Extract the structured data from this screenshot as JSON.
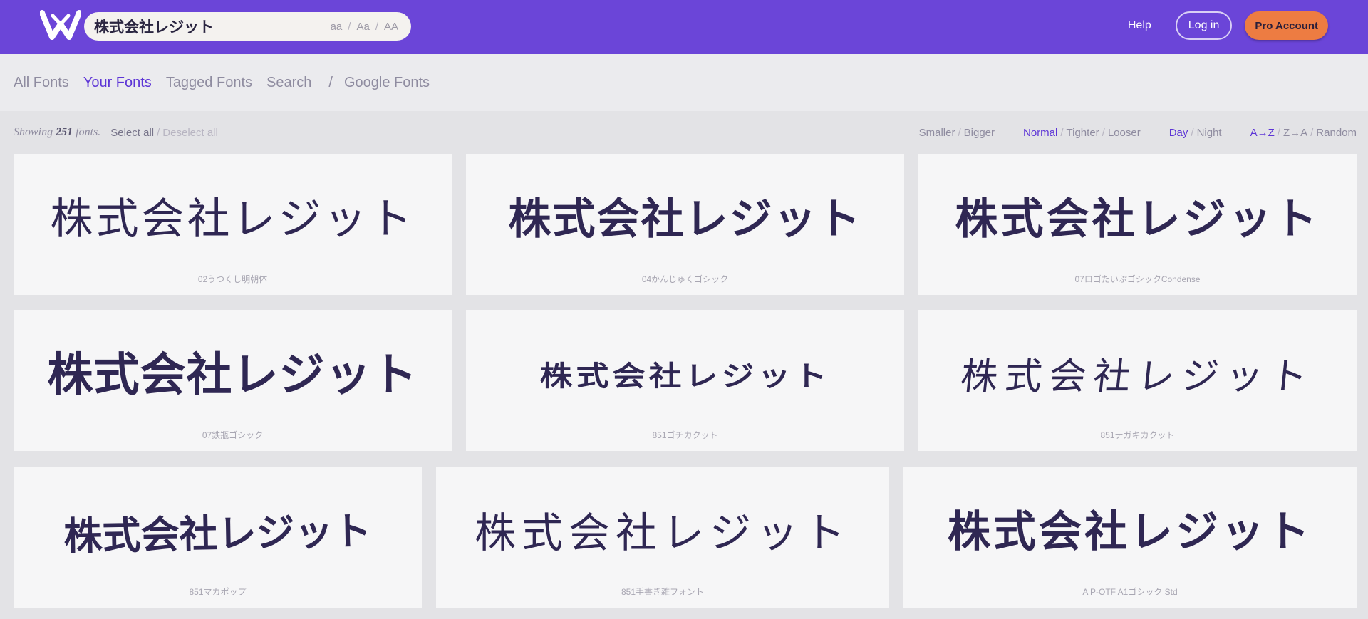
{
  "header": {
    "search_value": "株式会社レジット",
    "case_options": [
      "aa",
      "Aa",
      "AA"
    ],
    "help_label": "Help",
    "login_label": "Log in",
    "pro_label": "Pro Account"
  },
  "nav": {
    "tabs": [
      "All Fonts",
      "Your Fonts",
      "Tagged Fonts",
      "Search"
    ],
    "active": "Your Fonts",
    "google_label": "Google Fonts"
  },
  "toolbar": {
    "showing_prefix": "Showing",
    "count": "251",
    "showing_suffix": "fonts.",
    "select_all": "Select all",
    "deselect_all": "Deselect all",
    "size_options": [
      "Smaller",
      "Bigger"
    ],
    "spacing_options": [
      "Normal",
      "Tighter",
      "Looser"
    ],
    "spacing_active": "Normal",
    "theme_options": [
      "Day",
      "Night"
    ],
    "theme_active": "Day",
    "sort_options": [
      "A→Z",
      "Z→A",
      "Random"
    ],
    "sort_active": "A→Z"
  },
  "sample_text": "株式会社レジット",
  "fonts": [
    {
      "name": "02うつくし明朝体"
    },
    {
      "name": "04かんじゅくゴシック"
    },
    {
      "name": "07ロゴたいぷゴシックCondense"
    },
    {
      "name": "07鉄瓶ゴシック"
    },
    {
      "name": "851ゴチカクット"
    },
    {
      "name": "851テガキカクット"
    },
    {
      "name": "851マカポップ"
    },
    {
      "name": "851手書き雑フォント"
    },
    {
      "name": "A P-OTF A1ゴシック Std"
    }
  ],
  "colors": {
    "header_bg": "#6b45d8",
    "accent": "#5d35d6",
    "pro_button": "#ed7c42",
    "sample_text": "#2f2753"
  },
  "icons": {
    "logo": "wordmark-logo-icon"
  }
}
